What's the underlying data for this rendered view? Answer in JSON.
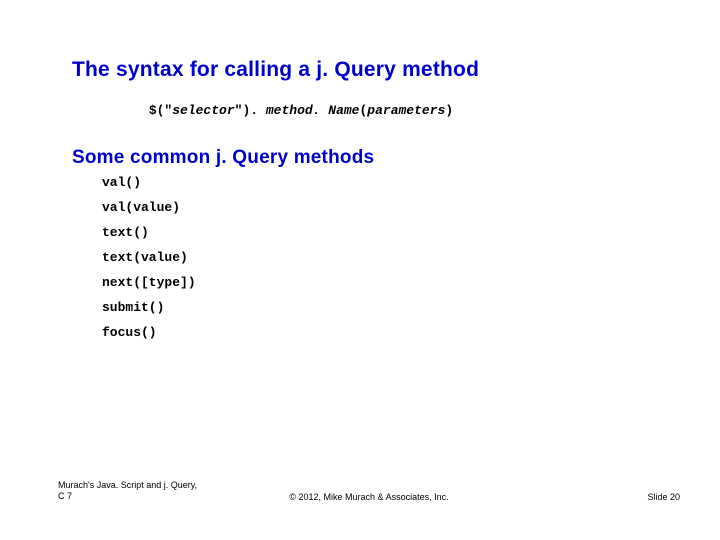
{
  "title": "The syntax for calling a j. Query method",
  "syntax": {
    "prefix": "$(\"",
    "selector": "selector",
    "mid": "\"). ",
    "method": "method. Name",
    "open_paren": "(",
    "params": "parameters",
    "close_paren": ")"
  },
  "subtitle": "Some common j. Query methods",
  "methods": [
    "val()",
    "val(value)",
    "text()",
    "text(value)",
    "next([type])",
    "submit()",
    "focus()"
  ],
  "footer": {
    "left_line1": "Murach's Java. Script and j. Query,",
    "left_line2": "C 7",
    "center": "© 2012, Mike Murach & Associates, Inc.",
    "right": "Slide 20"
  }
}
